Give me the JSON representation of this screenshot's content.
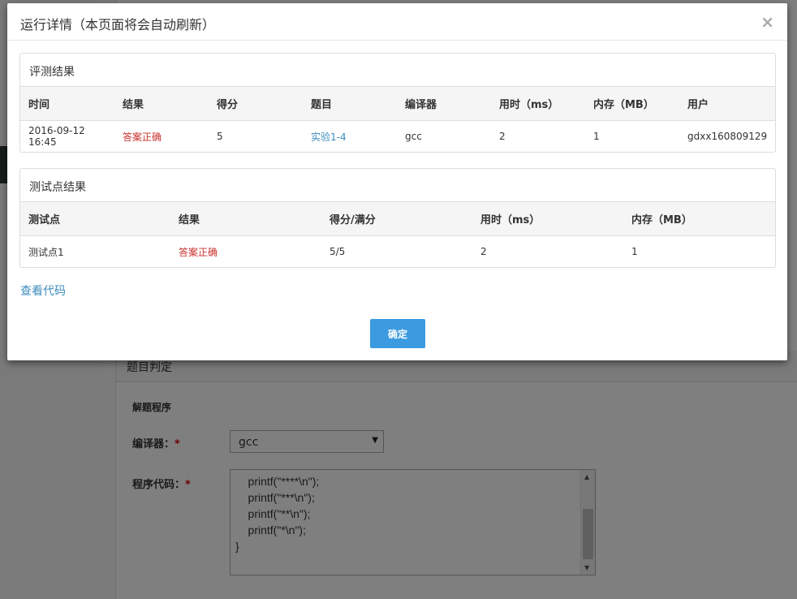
{
  "modal": {
    "title": "运行详情（本页面将会自动刷新）",
    "close_glyph": "×",
    "eval": {
      "heading": "评测结果",
      "columns": [
        "时间",
        "结果",
        "得分",
        "题目",
        "编译器",
        "用时（ms）",
        "内存（MB）",
        "用户"
      ],
      "row": {
        "time": "2016-09-12 16:45",
        "result": "答案正确",
        "score": "5",
        "problem": "实验1-4",
        "compiler": "gcc",
        "time_ms": "2",
        "memory_mb": "1",
        "user": "gdxx160809129"
      }
    },
    "testpoints": {
      "heading": "测试点结果",
      "columns": [
        "测试点",
        "结果",
        "得分/满分",
        "用时（ms）",
        "内存（MB）"
      ],
      "rows": [
        {
          "name": "测试点1",
          "result": "答案正确",
          "score": "5/5",
          "time_ms": "2",
          "memory_mb": "1"
        }
      ]
    },
    "view_code_label": "查看代码",
    "confirm_label": "确定"
  },
  "background": {
    "panel_title": "题目判定",
    "section_label": "解题程序",
    "compiler_label": "编译器：",
    "compiler_value": "gcc",
    "code_label": "程序代码：",
    "required_mark": "*",
    "code_text": "    printf(\"****\\n\");\n    printf(\"***\\n\");\n    printf(\"**\\n\");\n    printf(\"*\\n\");\n}"
  },
  "colors": {
    "accent_blue": "#3c9be0",
    "link_blue": "#3c8dbc",
    "error_red": "#c9302c"
  }
}
